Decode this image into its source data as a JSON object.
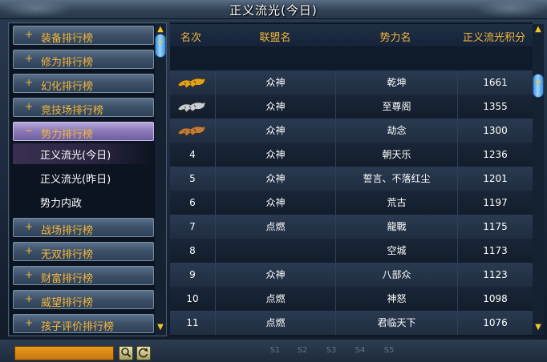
{
  "window": {
    "title": "正义流光(今日)"
  },
  "sidebar": {
    "items": [
      {
        "label": "装备排行榜",
        "expanded": false
      },
      {
        "label": "修为排行榜",
        "expanded": false
      },
      {
        "label": "幻化排行榜",
        "expanded": false
      },
      {
        "label": "竞技场排行榜",
        "expanded": false
      },
      {
        "label": "势力排行榜",
        "expanded": true
      },
      {
        "label": "战场排行榜",
        "expanded": false
      },
      {
        "label": "无双排行榜",
        "expanded": false
      },
      {
        "label": "财富排行榜",
        "expanded": false
      },
      {
        "label": "威望排行榜",
        "expanded": false
      },
      {
        "label": "孩子评价排行榜",
        "expanded": false
      }
    ],
    "expand_symbol": "+",
    "collapse_symbol": "−",
    "subitems": [
      {
        "label": "正义流光(今日)",
        "selected": true
      },
      {
        "label": "正义流光(昨日)",
        "selected": false
      },
      {
        "label": "势力内政",
        "selected": false
      }
    ]
  },
  "table": {
    "headers": {
      "rank": "名次",
      "alliance": "联盟名",
      "faction": "势力名",
      "score": "正义流光积分"
    },
    "rows": [
      {
        "rank": "",
        "medal": "gold-tiger-icon",
        "alliance": "众神",
        "faction": "乾坤",
        "score": "1661"
      },
      {
        "rank": "",
        "medal": "silver-tiger-icon",
        "alliance": "众神",
        "faction": "至尊阁",
        "score": "1355"
      },
      {
        "rank": "",
        "medal": "bronze-tiger-icon",
        "alliance": "众神",
        "faction": "劫念",
        "score": "1300"
      },
      {
        "rank": "4",
        "medal": "",
        "alliance": "众神",
        "faction": "朝天乐",
        "score": "1236"
      },
      {
        "rank": "5",
        "medal": "",
        "alliance": "众神",
        "faction": "誓言、不落红尘",
        "score": "1201"
      },
      {
        "rank": "6",
        "medal": "",
        "alliance": "众神",
        "faction": "荒古",
        "score": "1197"
      },
      {
        "rank": "7",
        "medal": "",
        "alliance": "点燃",
        "faction": "龍戰",
        "score": "1175"
      },
      {
        "rank": "8",
        "medal": "",
        "alliance": "",
        "faction": "空城",
        "score": "1173"
      },
      {
        "rank": "9",
        "medal": "",
        "alliance": "众神",
        "faction": "八部众",
        "score": "1123"
      },
      {
        "rank": "10",
        "medal": "",
        "alliance": "点燃",
        "faction": "神怒",
        "score": "1098"
      },
      {
        "rank": "11",
        "medal": "",
        "alliance": "点燃",
        "faction": "君临天下",
        "score": "1076"
      }
    ]
  },
  "bottombar": {
    "search_value": "",
    "search_button_icon": "magnifier-icon",
    "refresh_button_icon": "refresh-icon",
    "skill_slots": [
      "S1",
      "S2",
      "S3",
      "S4",
      "S5"
    ]
  },
  "colors": {
    "accent": "#f6b73c",
    "gold": "#e2a21b",
    "silver": "#c6ced8",
    "bronze": "#c27a3a"
  }
}
